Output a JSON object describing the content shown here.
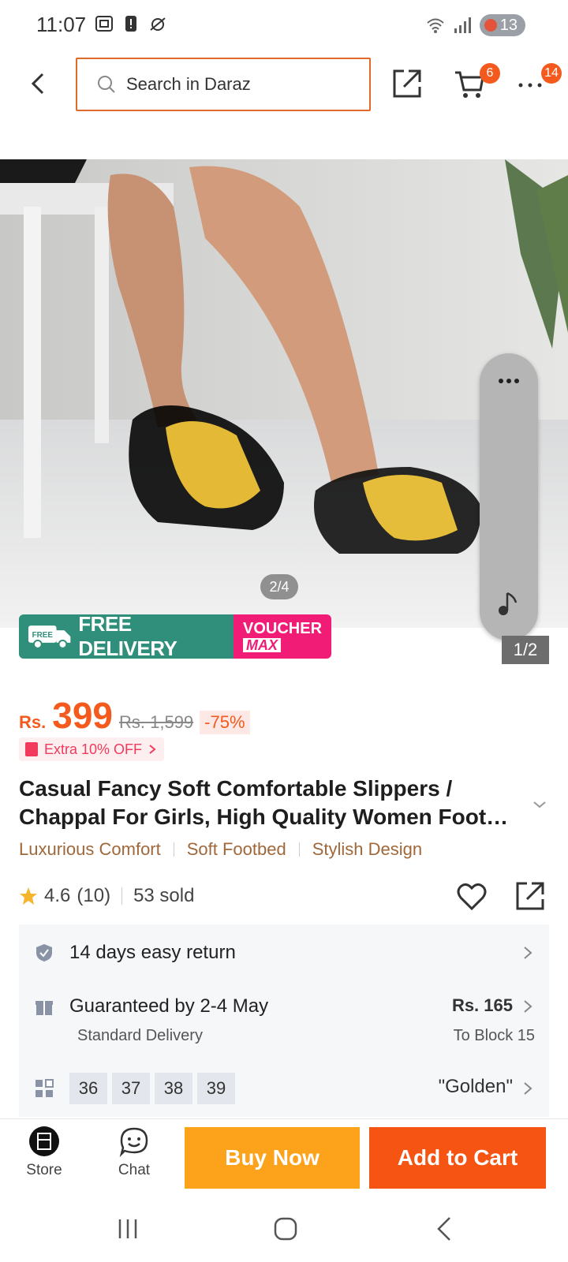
{
  "status": {
    "time": "11:07",
    "battery": "13"
  },
  "header": {
    "search_placeholder": "Search in Daraz",
    "cart_count": "6",
    "more_count": "14"
  },
  "gallery": {
    "counter": "2/4",
    "slide_indicator": "1/2"
  },
  "promo": {
    "free_delivery": "FREE DELIVERY",
    "truck_tag": "FREE",
    "voucher_line1": "VOUCHER",
    "voucher_line2": "MAX"
  },
  "price": {
    "currency": "Rs.",
    "value": "399",
    "original": "Rs. 1,599",
    "discount": "-75%",
    "extra_offer": "Extra 10% OFF"
  },
  "product": {
    "title": "Casual Fancy Soft Comfortable Slippers / Chappal For Girls, High Quality Women Foot…",
    "features": [
      "Luxurious Comfort",
      "Soft Footbed",
      "Stylish Design"
    ],
    "rating": "4.6",
    "review_count": "(10)",
    "sold": "53 sold"
  },
  "info": {
    "return_policy": "14 days easy return",
    "delivery_guarantee": "Guaranteed by 2-4 May",
    "delivery_type": "Standard Delivery",
    "delivery_fee": "Rs. 165",
    "delivery_location": "To Block 15",
    "sizes": [
      "36",
      "37",
      "38",
      "39"
    ],
    "selected_color": "\"Golden\""
  },
  "actions": {
    "store_label": "Store",
    "chat_label": "Chat",
    "buy_now": "Buy Now",
    "add_to_cart": "Add to Cart"
  },
  "colors": {
    "accent_orange": "#f45a1d",
    "buy_now_bg": "#fca21b",
    "add_cart_bg": "#f65413",
    "free_delivery_bg": "#2f8f7a",
    "voucher_bg": "#f01c76",
    "feature_text": "#a0683a"
  }
}
